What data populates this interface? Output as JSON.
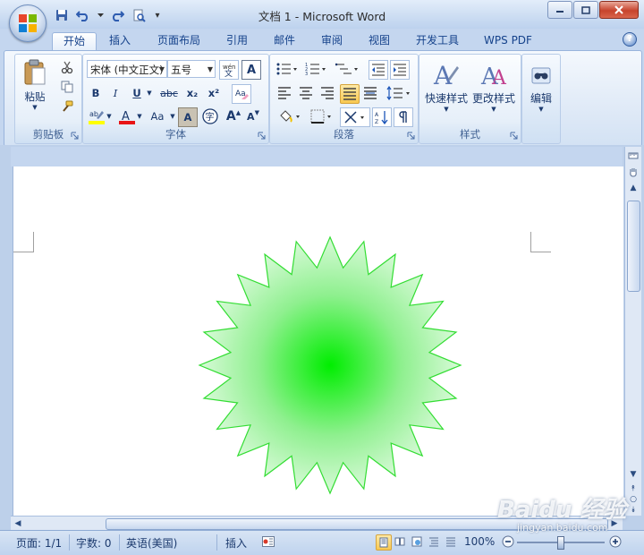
{
  "window": {
    "title": "文档 1 - Microsoft Word"
  },
  "quick_access": {
    "customize_symbol": "▾"
  },
  "tabs": [
    {
      "label": "开始",
      "active": true
    },
    {
      "label": "插入"
    },
    {
      "label": "页面布局"
    },
    {
      "label": "引用"
    },
    {
      "label": "邮件"
    },
    {
      "label": "审阅"
    },
    {
      "label": "视图"
    },
    {
      "label": "开发工具"
    },
    {
      "label": "WPS PDF"
    }
  ],
  "help_symbol": "?",
  "ribbon": {
    "clipboard": {
      "label": "剪贴板",
      "paste": "粘贴"
    },
    "font": {
      "label": "字体",
      "font_name": "宋体 (中文正文)",
      "font_size": "五号",
      "bold": "B",
      "italic": "I",
      "underline": "U",
      "strike": "abc",
      "subscript": "x₂",
      "superscript": "x²",
      "char_shading": "A",
      "change_case": "Aa",
      "grow": "A",
      "shrink": "A"
    },
    "paragraph": {
      "label": "段落"
    },
    "styles": {
      "label": "样式",
      "quick_styles": "快速样式",
      "change_styles": "更改样式"
    },
    "editing": {
      "label": "编辑"
    }
  },
  "document": {
    "shape": {
      "type": "24-point-star",
      "fill_center": "#00ee00",
      "fill_edge": "#d8fad8",
      "stroke": "#33dd33"
    }
  },
  "status": {
    "page": "页面: 1/1",
    "words": "字数: 0",
    "language": "英语(美国)",
    "mode": "插入",
    "zoom": "100%"
  },
  "watermark": {
    "main": "Baidu 经验",
    "sub": "jingyan.baidu.com"
  },
  "colors": {
    "ribbon_blue": "#c4d6ef",
    "text_blue": "#15428b",
    "highlight": "#f8c851"
  }
}
